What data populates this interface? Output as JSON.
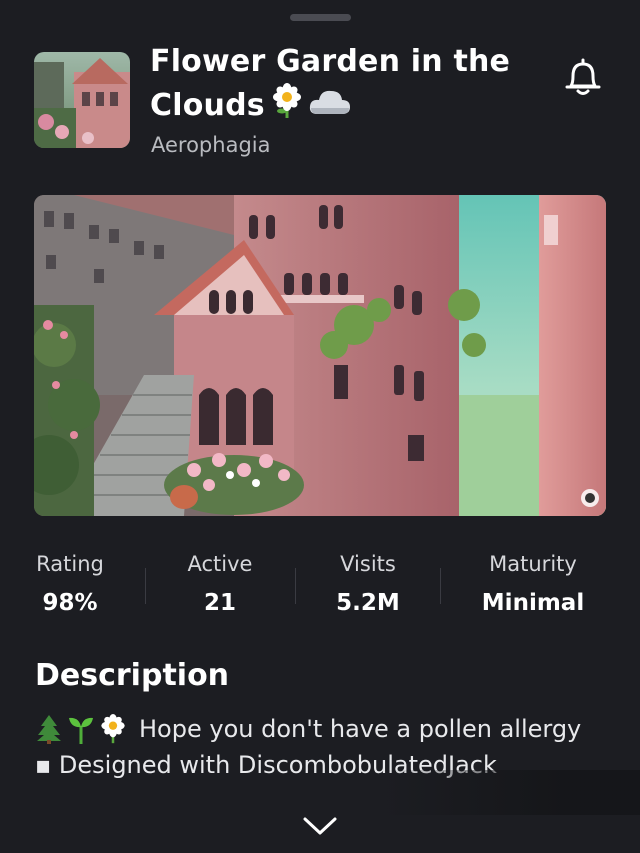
{
  "game": {
    "title_line1": "Flower Garden in the",
    "title_line2": "Clouds",
    "title_emojis": [
      "flower-emoji",
      "cloud-emoji"
    ],
    "creator": "Aerophagia"
  },
  "header_icons": {
    "notify": "bell-icon",
    "drag": "drag-handle"
  },
  "stats": [
    {
      "label": "Rating",
      "value": "98%"
    },
    {
      "label": "Active",
      "value": "21"
    },
    {
      "label": "Visits",
      "value": "5.2M"
    },
    {
      "label": "Maturity",
      "value": "Minimal"
    }
  ],
  "description": {
    "heading": "Description",
    "line1_emojis": [
      "tree-emoji",
      "seedling-emoji",
      "flower-emoji"
    ],
    "line1_text": "Hope you don't have a pollen allergy",
    "line2_text": "▪ Designed with DiscombobulatedJack"
  },
  "colors": {
    "background": "#1c1d22",
    "text_primary": "#ffffff",
    "text_secondary": "#b9bbc0",
    "divider": "#3a3b42"
  }
}
